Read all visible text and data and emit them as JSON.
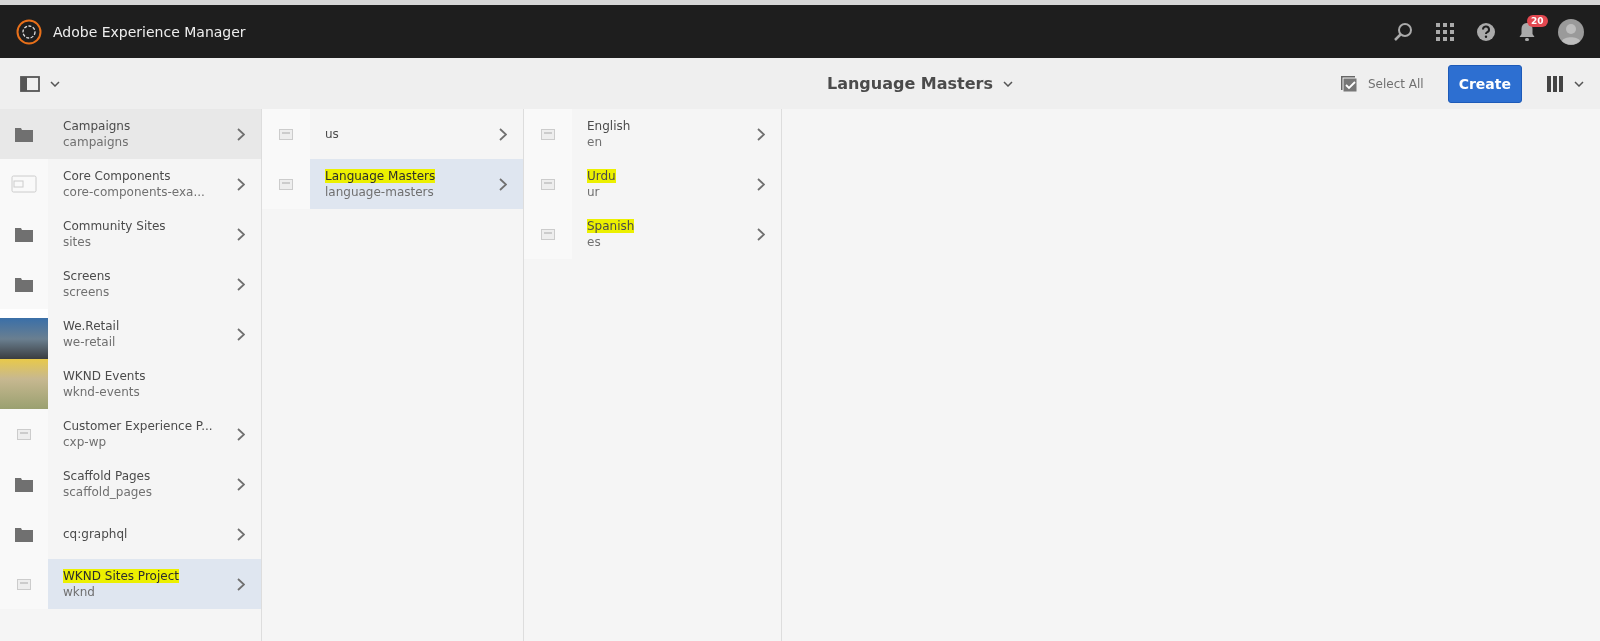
{
  "header": {
    "title": "Adobe Experience Manager",
    "notification_count": "20"
  },
  "toolbar": {
    "title": "Language Masters",
    "select_all": "Select All",
    "create": "Create"
  },
  "columns": [
    {
      "items": [
        {
          "kind": "folder",
          "title": "Campaigns",
          "name": "campaigns",
          "hovered": true,
          "selected": false,
          "highlighted": false,
          "has_children": true
        },
        {
          "kind": "component",
          "title": "Core Components",
          "name": "core-components-exa...",
          "hovered": false,
          "selected": false,
          "highlighted": false,
          "has_children": true
        },
        {
          "kind": "folder",
          "title": "Community Sites",
          "name": "sites",
          "hovered": false,
          "selected": false,
          "highlighted": false,
          "has_children": true
        },
        {
          "kind": "folder",
          "title": "Screens",
          "name": "screens",
          "hovered": false,
          "selected": false,
          "highlighted": false,
          "has_children": true
        },
        {
          "kind": "photo",
          "title": "We.Retail",
          "name": "we-retail",
          "hovered": false,
          "selected": false,
          "highlighted": false,
          "has_children": true
        },
        {
          "kind": "photo",
          "title": "WKND Events",
          "name": "wknd-events",
          "hovered": false,
          "selected": false,
          "highlighted": false,
          "has_children": false
        },
        {
          "kind": "page",
          "title": "Customer Experience P...",
          "name": "cxp-wp",
          "hovered": false,
          "selected": false,
          "highlighted": false,
          "has_children": true
        },
        {
          "kind": "folder",
          "title": "Scaffold Pages",
          "name": "scaffold_pages",
          "hovered": false,
          "selected": false,
          "highlighted": false,
          "has_children": true
        },
        {
          "kind": "folder",
          "title": "cq:graphql",
          "hovered": false,
          "selected": false,
          "highlighted": false,
          "has_children": true
        },
        {
          "kind": "page",
          "title": "WKND Sites Project",
          "name": "wknd",
          "hovered": false,
          "selected": true,
          "highlighted": true,
          "has_children": true
        }
      ]
    },
    {
      "items": [
        {
          "kind": "page",
          "title": "us",
          "hovered": false,
          "selected": false,
          "highlighted": false,
          "has_children": true
        },
        {
          "kind": "page",
          "title": "Language Masters",
          "name": "language-masters",
          "hovered": false,
          "selected": true,
          "highlighted": true,
          "has_children": true
        }
      ]
    },
    {
      "items": [
        {
          "kind": "page",
          "title": "English",
          "name": "en",
          "hovered": false,
          "selected": false,
          "highlighted": false,
          "has_children": true
        },
        {
          "kind": "page",
          "title": "Urdu",
          "name": "ur",
          "hovered": false,
          "selected": false,
          "highlighted": true,
          "has_children": true
        },
        {
          "kind": "page",
          "title": "Spanish",
          "name": "es",
          "hovered": false,
          "selected": false,
          "highlighted": true,
          "has_children": true
        }
      ]
    }
  ]
}
